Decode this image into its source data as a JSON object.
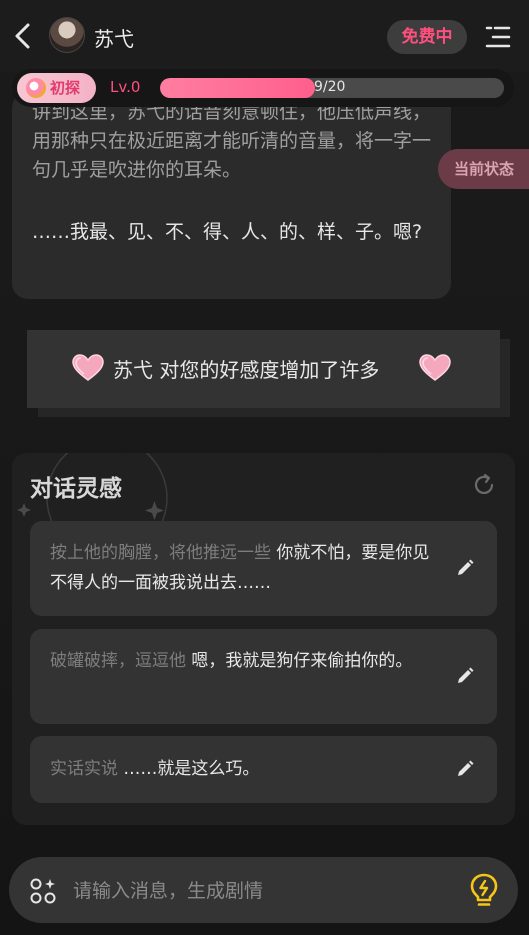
{
  "header": {
    "character_name": "苏弋",
    "free_badge": "免费中",
    "icons": {
      "back": "chevron-left-icon",
      "menu": "list-menu-icon"
    }
  },
  "level": {
    "stage": "初探",
    "level": "Lv.0",
    "progress_text": "9/20",
    "progress_fraction": 0.45,
    "accent_color": "#ff5f8c"
  },
  "story": {
    "paragraph_1": "讲到这里，苏弋的话音刻意顿住，他压低声线，用那种只在极近距离才能听清的音量，将一字一句几乎是吹进你的耳朵。",
    "paragraph_2": "……我最、见、不、得、人、的、样、子。嗯?",
    "state_button": "当前状态"
  },
  "notice": {
    "name": "苏弋",
    "text": " 对您的好感度增加了许多"
  },
  "inspiration": {
    "title": "对话灵感",
    "suggestions": [
      {
        "action": "按上他的胸膛，将他推远一些 ",
        "speech": "你就不怕，要是你见不得人的一面被我说出去……"
      },
      {
        "action": "破罐破摔，逗逗他 ",
        "speech": "嗯，我就是狗仔来偷拍你的。"
      },
      {
        "action": "实话实说 ",
        "speech": "……就是这么巧。"
      }
    ]
  },
  "input": {
    "placeholder": "请输入消息，生成剧情"
  }
}
